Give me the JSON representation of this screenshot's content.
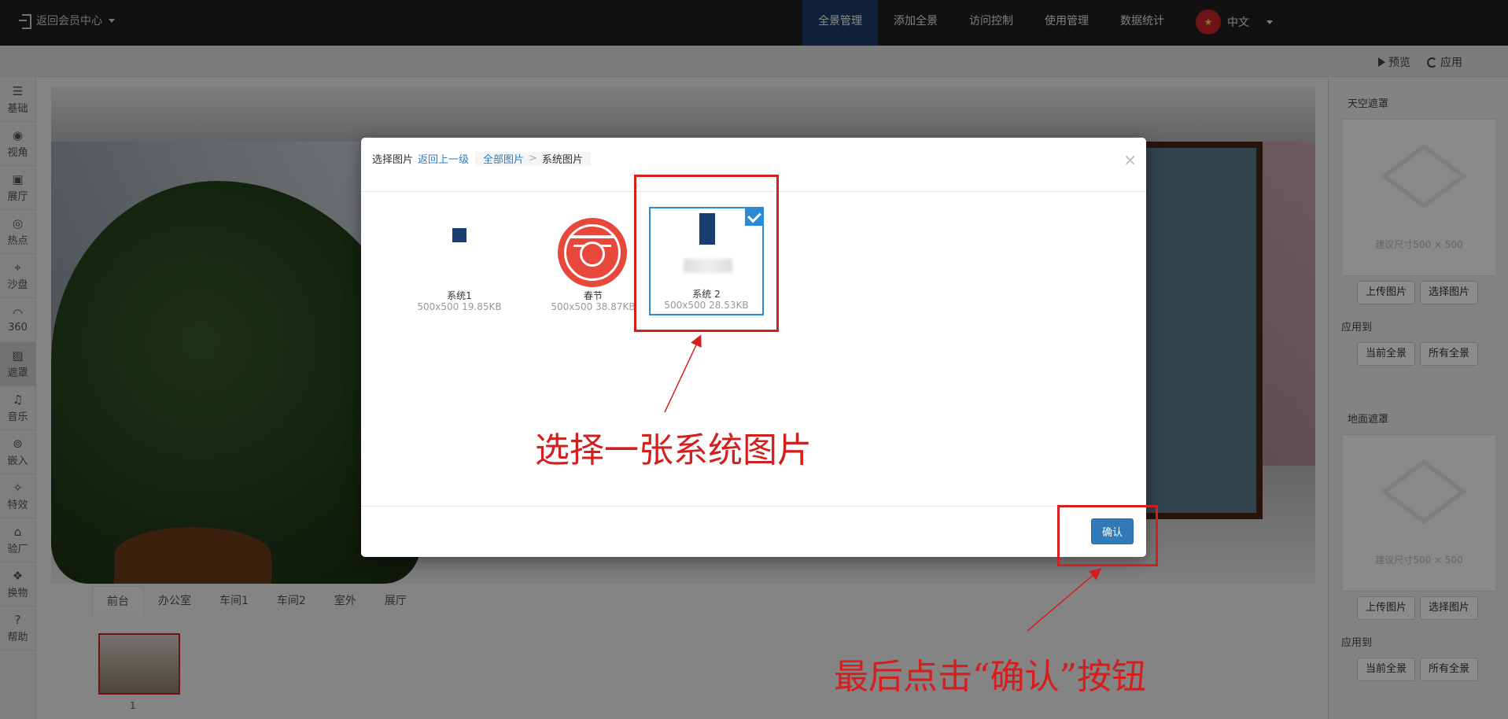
{
  "topbar": {
    "back_label": "返回会员中心",
    "nav": [
      "全景管理",
      "添加全景",
      "访问控制",
      "使用管理",
      "数据统计"
    ],
    "active_nav": "全景管理",
    "language": "中文"
  },
  "toolbar": {
    "preview_label": "预览",
    "apply_label": "应用"
  },
  "sidebar": {
    "items": [
      {
        "icon": "list-icon",
        "glyph": "☰",
        "label": "基础"
      },
      {
        "icon": "eye-icon",
        "glyph": "◉",
        "label": "视角"
      },
      {
        "icon": "gallery-icon",
        "glyph": "▣",
        "label": "展厅"
      },
      {
        "icon": "hotspot-icon",
        "glyph": "◎",
        "label": "热点"
      },
      {
        "icon": "sandtable-icon",
        "glyph": "⌖",
        "label": "沙盘"
      },
      {
        "icon": "360-icon",
        "glyph": "◠",
        "label": "360"
      },
      {
        "icon": "mask-icon",
        "glyph": "▨",
        "label": "遮罩"
      },
      {
        "icon": "music-icon",
        "glyph": "♫",
        "label": "音乐"
      },
      {
        "icon": "embed-icon",
        "glyph": "⊚",
        "label": "嵌入"
      },
      {
        "icon": "effects-icon",
        "glyph": "✧",
        "label": "特效"
      },
      {
        "icon": "factory-icon",
        "glyph": "⌂",
        "label": "验厂"
      },
      {
        "icon": "swap-icon",
        "glyph": "❖",
        "label": "换物"
      },
      {
        "icon": "help-icon",
        "glyph": "?",
        "label": "帮助"
      }
    ],
    "active_label": "遮罩"
  },
  "scenes": {
    "tabs": [
      "前台",
      "办公室",
      "车间1",
      "车间2",
      "室外",
      "展厅"
    ],
    "active_tab": "前台",
    "thumb_number": "1"
  },
  "right_panel": {
    "sky_title": "天空遮罩",
    "ground_title": "地面遮罩",
    "size_hint": "建议尺寸500 × 500",
    "upload_label": "上传图片",
    "select_label": "选择图片",
    "apply_to_label": "应用到",
    "current_label": "当前全景",
    "all_label": "所有全景"
  },
  "modal": {
    "title": "选择图片",
    "back_link": "返回上一级",
    "crumb_all": "全部图片",
    "crumb_sep": ">",
    "crumb_current": "系统图片",
    "close": "×",
    "images": [
      {
        "name": "系统1",
        "meta": "500x500 19.85KB",
        "selected": false
      },
      {
        "name": "春节",
        "meta": "500x500 38.87KB",
        "selected": false
      },
      {
        "name": "系统 2",
        "meta": "500x500 28.53KB",
        "selected": true
      }
    ],
    "confirm_label": "确认",
    "seal_char": "春"
  },
  "annotations": {
    "select_hint": "选择一张系统图片",
    "confirm_hint": "最后点击“确认”按钮",
    "color": "#d41f1f"
  }
}
